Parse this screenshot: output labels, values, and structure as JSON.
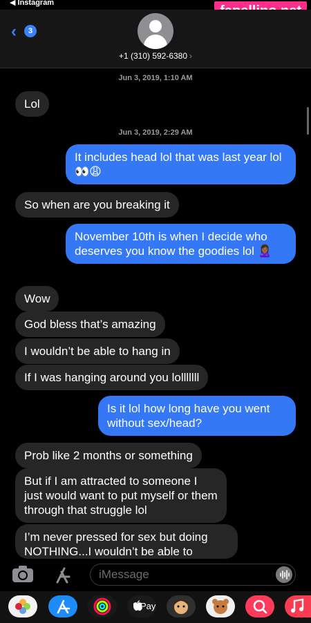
{
  "status": {
    "back_app": "◀ Instagram"
  },
  "watermark": "fapellino.net",
  "header": {
    "back_badge": "3",
    "contact_name": "+1 (310) 592-6380",
    "chevron": "›"
  },
  "timestamps": [
    "Jun 3, 2019, 1:10 AM",
    "Jun 3, 2019, 2:29 AM"
  ],
  "messages": [
    {
      "dir": "recv",
      "text": "Lol"
    },
    {
      "dir": "sent",
      "text": "It includes head lol that was last year lol 👀😩"
    },
    {
      "dir": "recv",
      "text": "So when are you breaking it"
    },
    {
      "dir": "sent",
      "text": "November 10th is when I decide who deserves you know the goodies lol 🙎🏾‍♀️"
    },
    {
      "dir": "recv",
      "text": "Wow"
    },
    {
      "dir": "recv",
      "text": "God bless that’s amazing"
    },
    {
      "dir": "recv",
      "text": "I wouldn’t be able to hang in"
    },
    {
      "dir": "recv",
      "text": "If I was hanging around you lolllllll"
    },
    {
      "dir": "sent",
      "text": "Is it lol how long have you went without sex/head?"
    },
    {
      "dir": "recv",
      "text": "Prob like 2 months or something"
    },
    {
      "dir": "recv",
      "text": "But if I am attracted to someone I just would want to put myself or them through that struggle lol"
    },
    {
      "dir": "recv",
      "text": "I’m never pressed for sex but doing NOTHING...I wouldn’t be able to"
    }
  ],
  "input": {
    "placeholder": "iMessage"
  },
  "app_drawer": {
    "apps": [
      "photos-app-icon",
      "app-store-app-icon",
      "activity-app-icon",
      "apple-pay-app-icon",
      "memoji-app-icon",
      "animoji-app-icon",
      "search-images-app-icon",
      "music-app-icon"
    ],
    "apple_pay_label": "Pay"
  },
  "colors": {
    "sent_bubble": "#3478f6",
    "recv_bubble": "#262626",
    "accent": "#3b82f6",
    "watermark_bg": "#ff2d8a"
  }
}
